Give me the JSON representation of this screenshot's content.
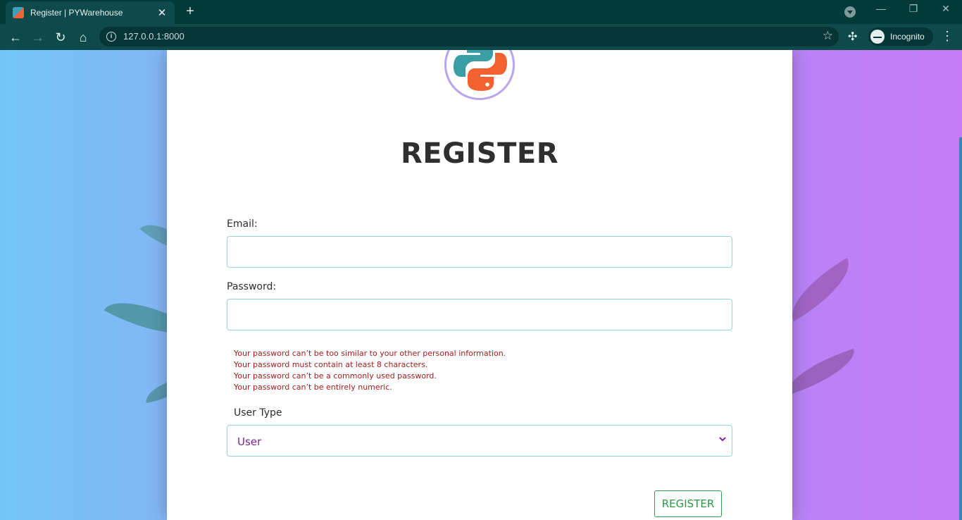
{
  "browser": {
    "tab_title": "Register | PYWarehouse",
    "url": "127.0.0.1:8000",
    "profile_label": "Incognito"
  },
  "form": {
    "heading": "REGISTER",
    "email_label": "Email:",
    "email_value": "",
    "password_label": "Password:",
    "password_value": "",
    "password_help": [
      "Your password can’t be too similar to your other personal information.",
      "Your password must contain at least 8 characters.",
      "Your password can’t be a commonly used password.",
      "Your password can’t be entirely numeric."
    ],
    "user_type_label": "User Type",
    "user_type_selected": "User",
    "submit_label": "REGISTER"
  },
  "colors": {
    "chrome_accent": "#0e4a4b",
    "submit_button": "#279a49",
    "help_text": "#a51d1d",
    "select_text": "#7f259b"
  }
}
